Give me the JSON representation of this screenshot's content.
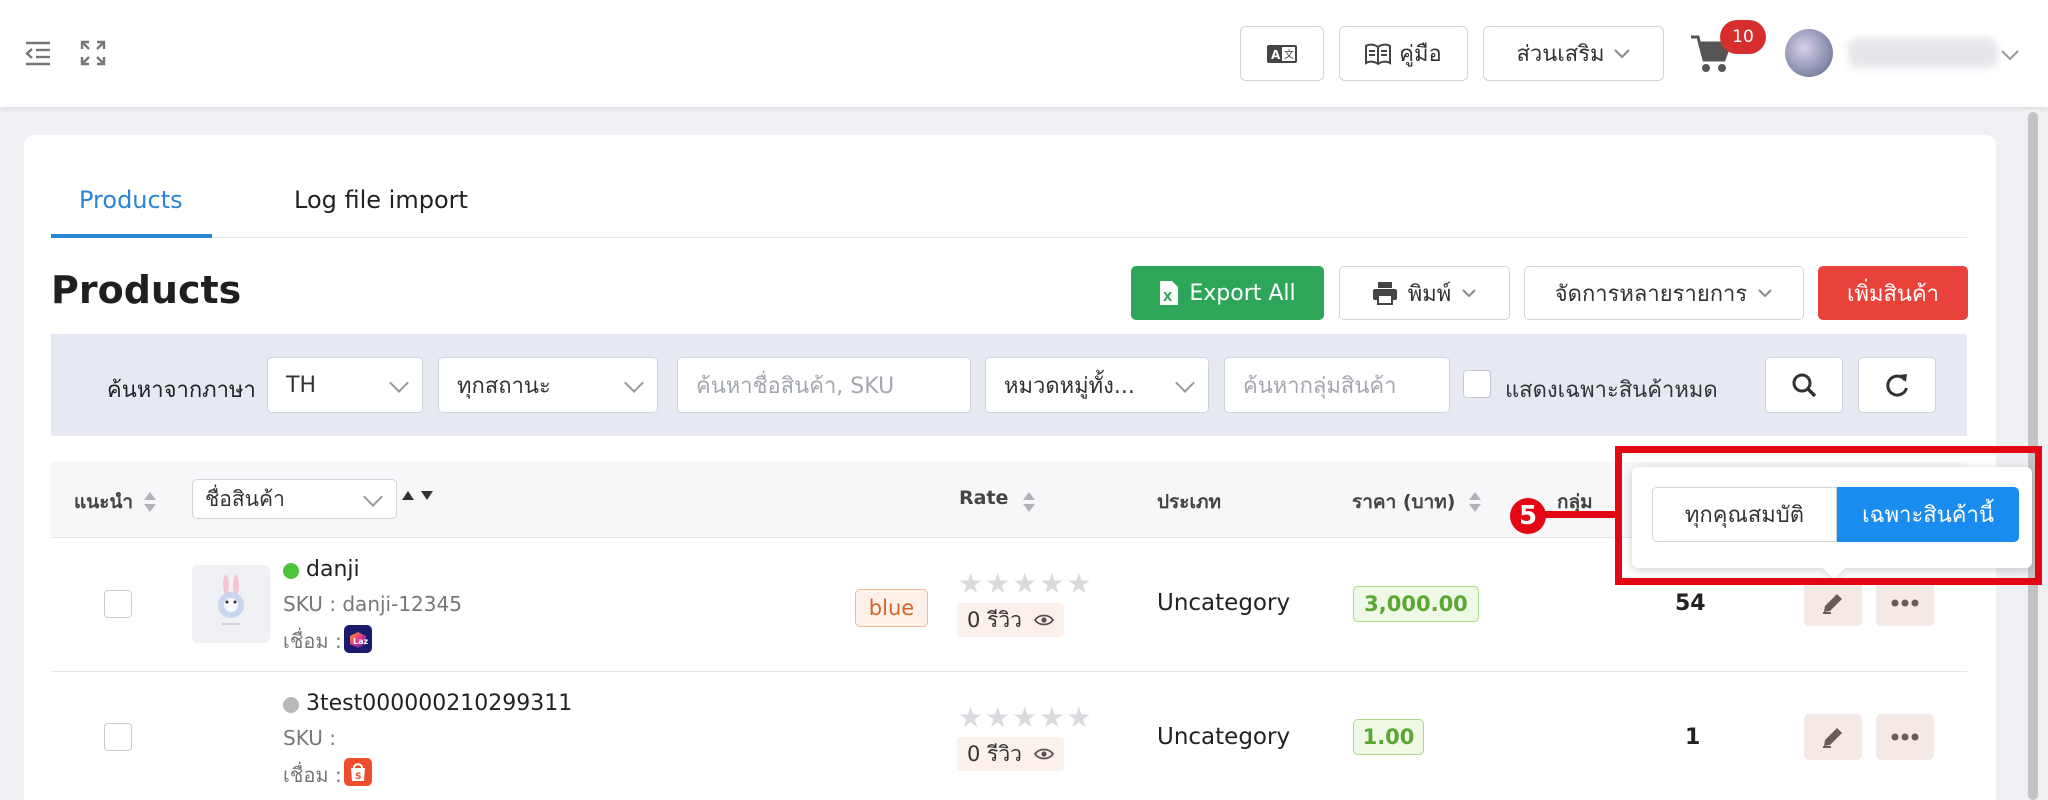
{
  "topbar": {
    "manual_label": "คู่มือ",
    "addons_label": "ส่วนเสริม",
    "cart_count": "10",
    "translate_icon": "translate-icon"
  },
  "tabs": [
    {
      "label": "Products",
      "active": true
    },
    {
      "label": "Log file import",
      "active": false
    }
  ],
  "page": {
    "title": "Products",
    "export_label": "Export All",
    "print_label": "พิมพ์",
    "bulk_label": "จัดการหลายรายการ",
    "add_label": "เพิ่มสินค้า"
  },
  "filters": {
    "search_by_language_label": "ค้นหาจากภาษา",
    "language_value": "TH",
    "status_value": "ทุกสถานะ",
    "name_sku_placeholder": "ค้นหาชื่อสินค้า, SKU",
    "category_value": "หมวดหมู่ทั้ง...",
    "group_placeholder": "ค้นหากลุ่มสินค้า",
    "out_of_stock_label": "แสดงเฉพาะสินค้าหมด"
  },
  "table": {
    "headers": {
      "recommend": "แนะนำ",
      "name_select": "ชื่อสินค้า",
      "rate": "Rate",
      "type": "ประเภท",
      "price": "ราคา (บาท)",
      "group": "กลุ่ม"
    },
    "rows": [
      {
        "name": "danji",
        "sku": "SKU : danji-12345",
        "link_label": "เชื่อม :",
        "tag": "blue",
        "reviews": "0 รีวิว",
        "category": "Uncategory",
        "price": "3,000.00",
        "count": "54",
        "status_color": "#4cc43a"
      },
      {
        "name": "3test000000210299311",
        "sku": "SKU :",
        "link_label": "เชื่อม :",
        "tag": "",
        "reviews": "0 รีวิว",
        "category": "Uncategory",
        "price": "1.00",
        "count": "1",
        "status_color": "#b8b8b8"
      }
    ]
  },
  "popup": {
    "all_properties_label": "ทุกคุณสมบัติ",
    "this_product_label": "เฉพาะสินค้านี้",
    "step_number": "5"
  },
  "colors": {
    "accent_blue": "#2b84d6",
    "export_green": "#2ea65a",
    "add_red": "#e8423a",
    "highlight_red": "#e30613"
  }
}
